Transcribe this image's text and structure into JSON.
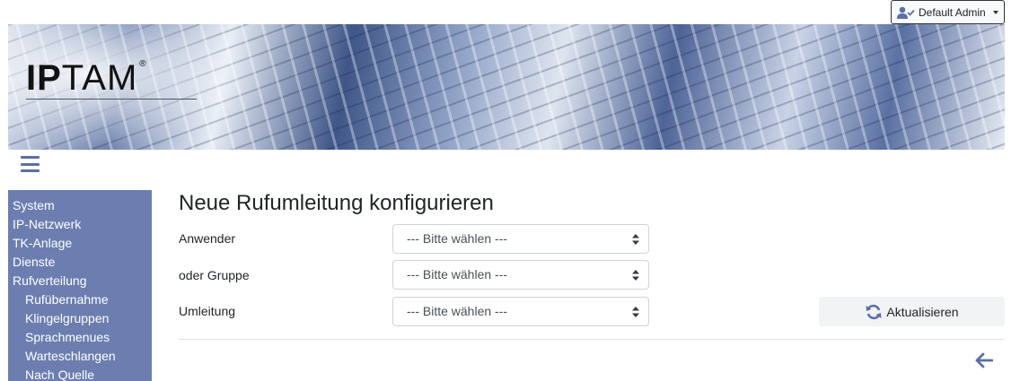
{
  "user_menu": {
    "label": "Default Admin",
    "icon": "user-check-icon"
  },
  "logo": {
    "text_bold": "IP",
    "text_rest": "TAM",
    "mark": "®"
  },
  "nav_toggle": {
    "icon": "hamburger-menu-icon"
  },
  "sidebar": {
    "items": [
      {
        "label": "System",
        "level": 1
      },
      {
        "label": "IP-Netzwerk",
        "level": 1
      },
      {
        "label": "TK-Anlage",
        "level": 1
      },
      {
        "label": "Dienste",
        "level": 1
      },
      {
        "label": "Rufverteilung",
        "level": 1
      },
      {
        "label": "Rufübernahme",
        "level": 2
      },
      {
        "label": "Klingelgruppen",
        "level": 2
      },
      {
        "label": "Sprachmenues",
        "level": 2
      },
      {
        "label": "Warteschlangen",
        "level": 2
      },
      {
        "label": "Nach Quelle",
        "level": 2
      }
    ]
  },
  "main": {
    "title": "Neue Rufumleitung konfigurieren",
    "fields": [
      {
        "label": "Anwender",
        "value": "--- Bitte wählen ---"
      },
      {
        "label": "oder Gruppe",
        "value": "--- Bitte wählen ---"
      },
      {
        "label": "Umleitung",
        "value": "--- Bitte wählen ---"
      }
    ],
    "refresh_button": {
      "label": "Aktualisieren",
      "icon": "refresh-icon"
    },
    "back_icon": "arrow-left-icon"
  },
  "colors": {
    "sidebar_bg": "#6c7eb0",
    "accent": "#5b6fa6",
    "banner_blue": "#3f5688"
  }
}
